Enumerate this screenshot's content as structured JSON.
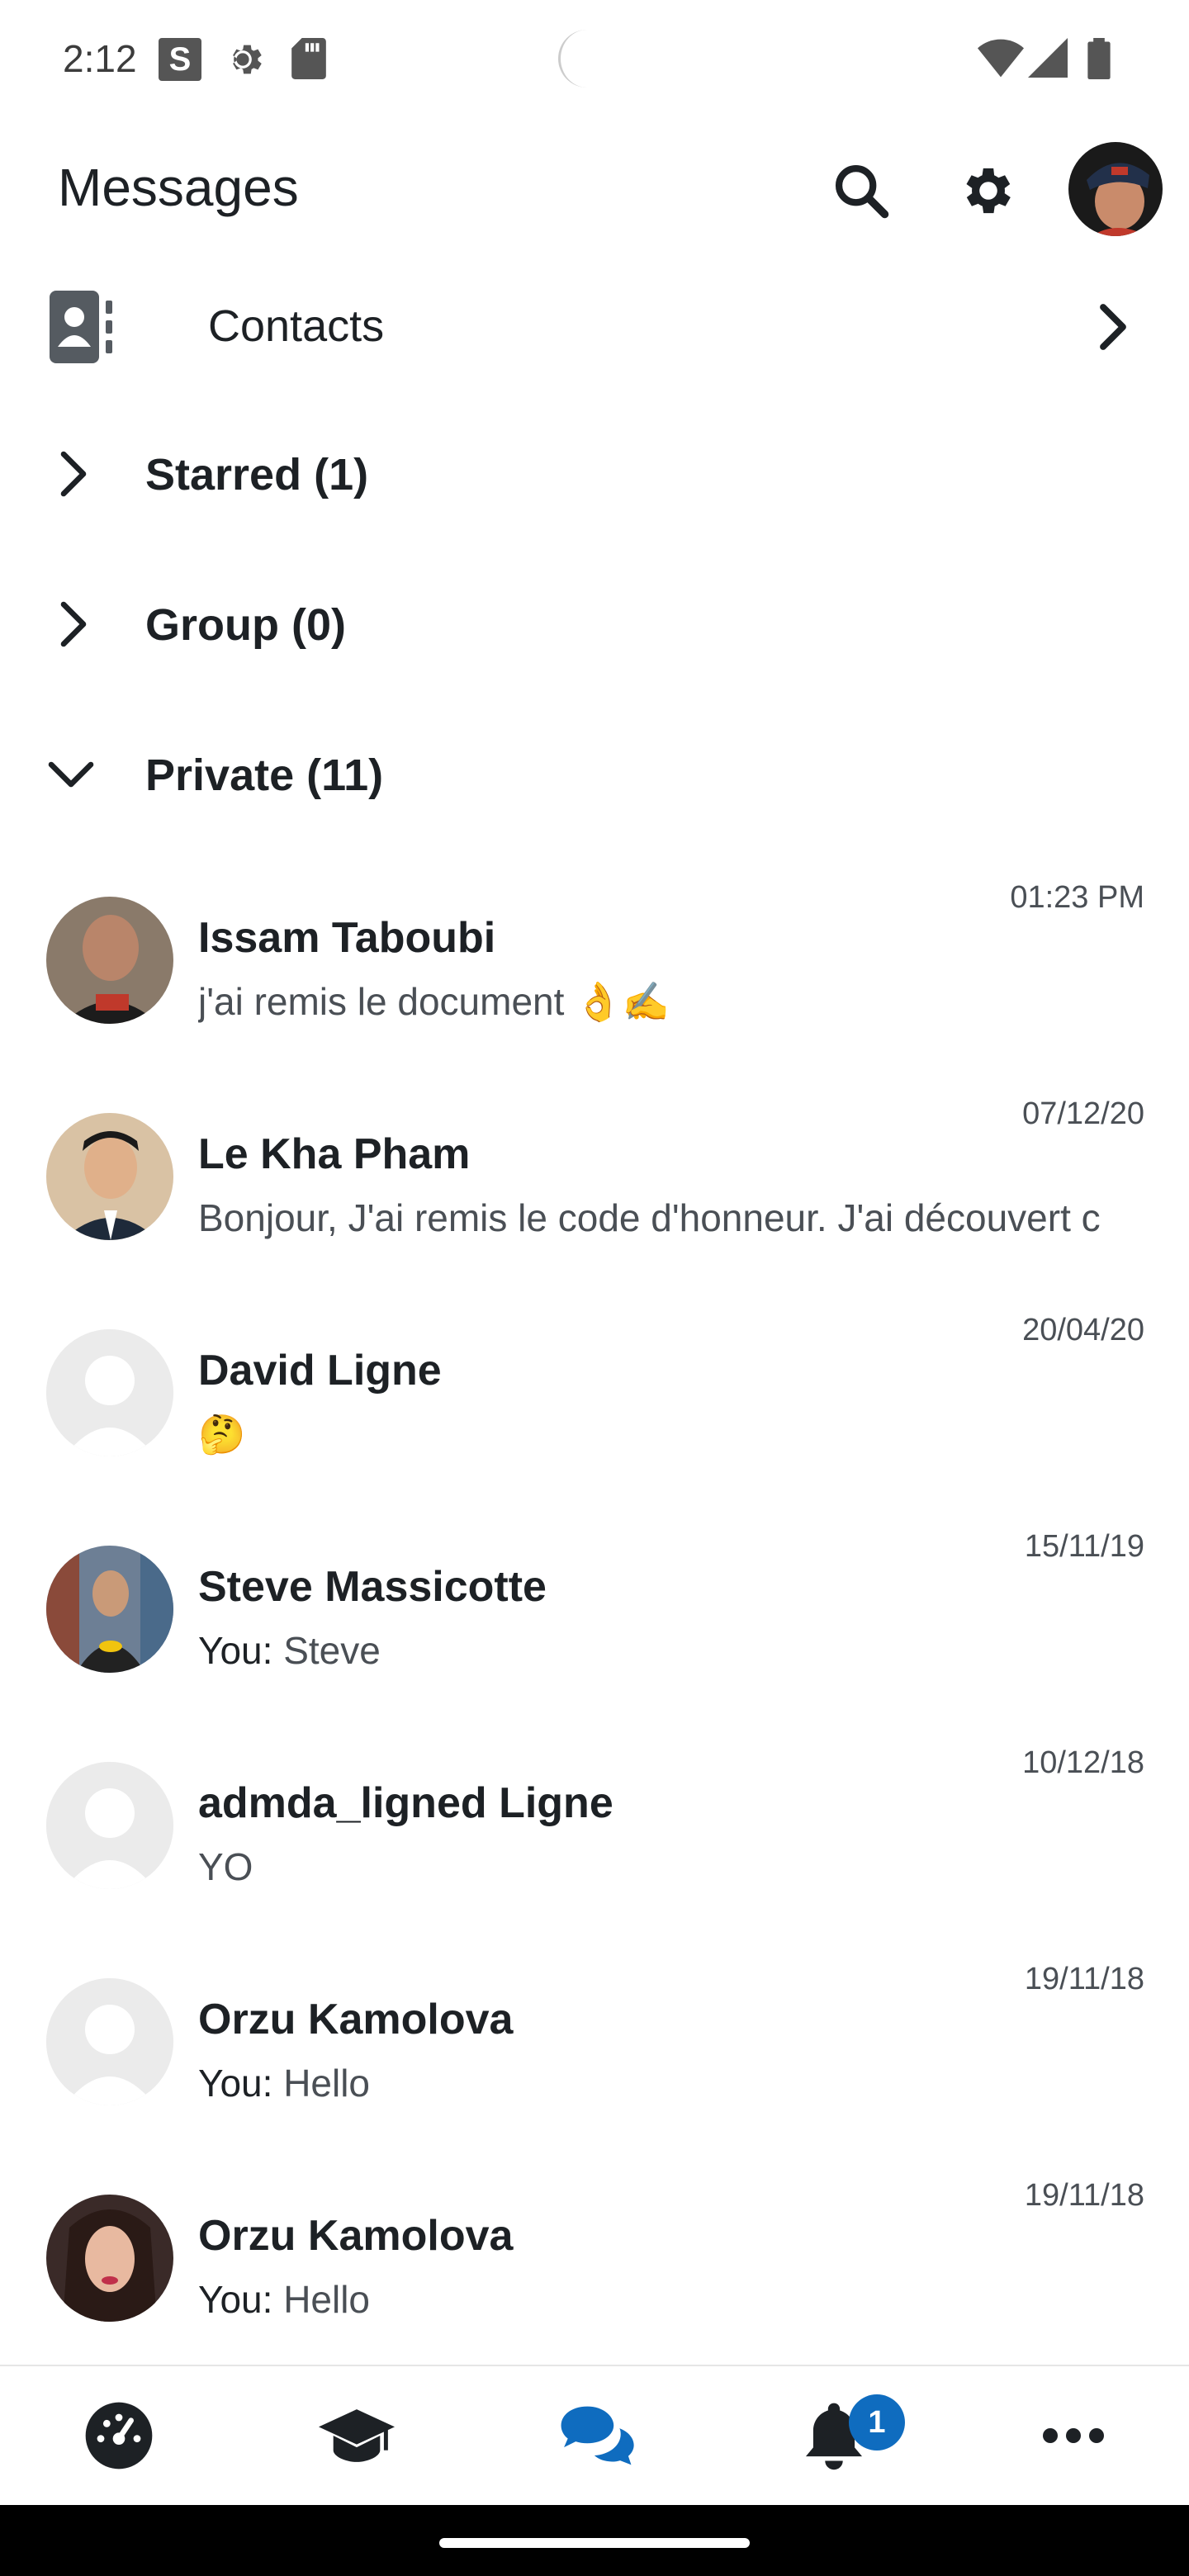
{
  "status_bar": {
    "time": "2:12",
    "s_icon_label": "S",
    "icons": [
      "s-icon",
      "gear-icon",
      "sd-card-icon",
      "wifi-icon",
      "signal-icon",
      "battery-icon"
    ]
  },
  "header": {
    "title": "Messages",
    "icons": [
      "search-icon",
      "settings-icon",
      "user-avatar"
    ]
  },
  "contacts": {
    "label": "Contacts"
  },
  "sections": {
    "starred": {
      "label": "Starred (1)"
    },
    "group": {
      "label": "Group (0)"
    },
    "private": {
      "label": "Private (11)"
    }
  },
  "conversations": [
    {
      "name": "Issam Taboubi",
      "preview": "j'ai remis le document 👌✍️",
      "you_prefix": "",
      "time": "01:23 PM"
    },
    {
      "name": "Le Kha Pham",
      "preview": "Bonjour, J'ai remis le code d'honneur. J'ai découvert c",
      "you_prefix": "",
      "time": "07/12/20"
    },
    {
      "name": "David Ligne",
      "preview": "🤔",
      "you_prefix": "",
      "time": "20/04/20"
    },
    {
      "name": "Steve Massicotte",
      "preview": "Steve",
      "you_prefix": "You:",
      "time": "15/11/19"
    },
    {
      "name": "admda_ligned Ligne",
      "preview": "YO",
      "you_prefix": "",
      "time": "10/12/18"
    },
    {
      "name": "Orzu Kamolova",
      "preview": "Hello",
      "you_prefix": "You:",
      "time": "19/11/18"
    },
    {
      "name": "Orzu Kamolova",
      "preview": "Hello",
      "you_prefix": "You:",
      "time": "19/11/18"
    }
  ],
  "bottom_nav": {
    "items": [
      "dashboard-icon",
      "courses-icon",
      "messages-icon",
      "notifications-icon",
      "more-icon"
    ],
    "active": "messages-icon",
    "notification_badge": "1"
  },
  "colors": {
    "accent": "#0f6cbf",
    "text": "#1d2125",
    "muted": "#4a4f55"
  }
}
